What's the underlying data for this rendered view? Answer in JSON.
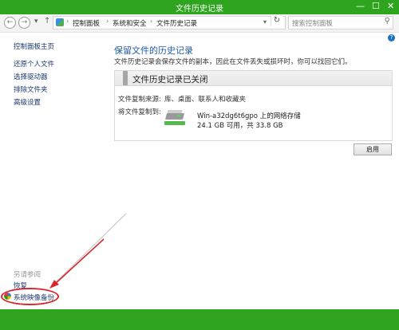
{
  "window": {
    "title": "文件历史记录",
    "minimize_glyph": "—",
    "maximize_glyph": "☐",
    "close_glyph": "✕"
  },
  "address": {
    "back_glyph": "←",
    "forward_glyph": "→",
    "history_glyph": "▾",
    "up_glyph": "↑",
    "breadcrumb": [
      "控制面板",
      "系统和安全",
      "文件历史记录"
    ],
    "separator": "›",
    "dropdown_glyph": "▾",
    "refresh_glyph": "↻",
    "search_placeholder": "搜索控制面板",
    "search_glyph": "⚲",
    "help_glyph": "?"
  },
  "sidebar": {
    "items": [
      "控制面板主页",
      "还原个人文件",
      "选择驱动器",
      "排除文件夹",
      "高级设置"
    ],
    "see_also": "另请参阅",
    "see_also_items": [
      "恢复",
      "系统映像备份"
    ]
  },
  "main": {
    "heading": "保留文件的历史记录",
    "description": "文件历史记录会保存文件的副本，因此在文件丢失或损坏时，你可以找回它们。",
    "status": "文件历史记录已关闭",
    "copy_from_label": "文件复制来源:",
    "copy_from_value": "库、桌面、联系人和收藏夹",
    "copy_to_label": "将文件复制到:",
    "drive_name": "Win-a32dg6t6gpo 上的网络存储",
    "drive_space": "24.1 GB 可用，共 33.8 GB",
    "enable_button": "启用"
  },
  "colors": {
    "frame_green": "#2fa41f",
    "annotation_red": "#d6282c",
    "heading_blue": "#1e5aa8"
  }
}
